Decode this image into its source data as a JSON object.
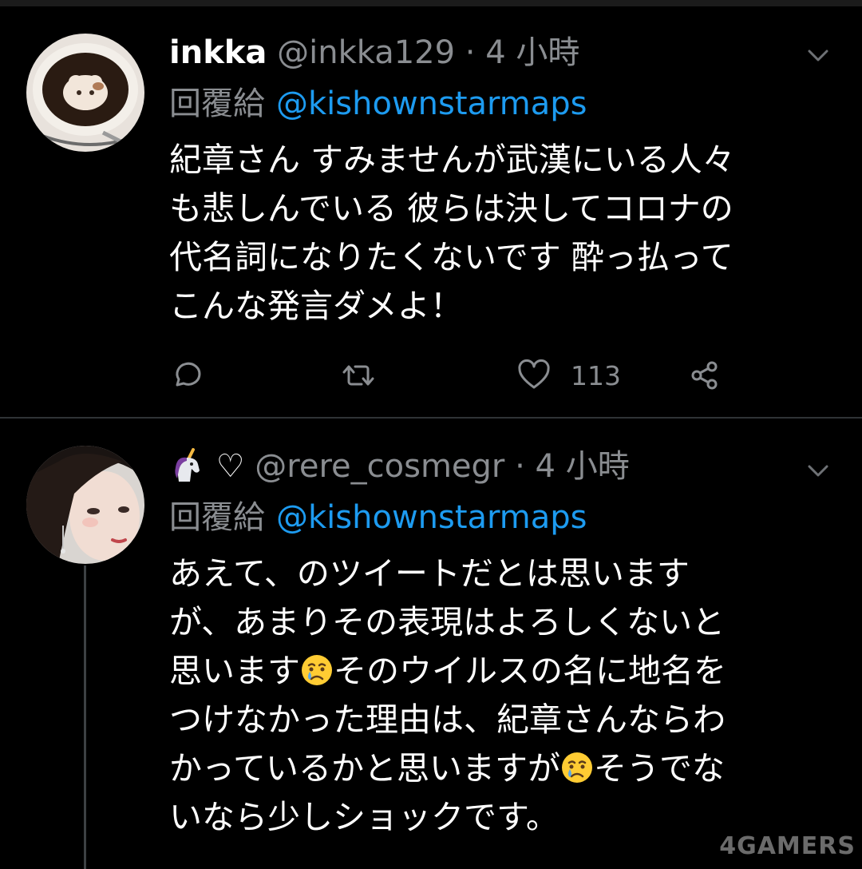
{
  "tweets": [
    {
      "display_name": "inkka",
      "handle": "@inkka129",
      "separator": "·",
      "time": "4 小時",
      "reply_label": "回覆給",
      "reply_to": "@kishownstarmaps",
      "lines": [
        "紀章さん すみませんが武漢にいる人々",
        "も悲しんでいる 彼らは決してコロナの",
        "代名詞になりたくないです 酔っ払って",
        "こんな発言ダメよ！"
      ],
      "like_count": "113"
    },
    {
      "display_name_icons": [
        "unicorn-emoji",
        "heart-outline"
      ],
      "display_name_heart": "♡",
      "handle": "@rere_cosmegr",
      "separator": "·",
      "time": "4 小時",
      "reply_label": "回覆給",
      "reply_to": "@kishownstarmaps",
      "lines": [
        "あえて、のツイートだとは思います",
        "が、あまりその表現はよろしくないと",
        "思います",
        "そのウイルスの名に地名を",
        "つけなかった理由は、紀章さんならわ",
        "かっているかと思いますが",
        "そうでな",
        "いなら少しショックです。"
      ]
    }
  ],
  "watermark": "4GAMERS",
  "colors": {
    "background": "#000000",
    "secondary_text": "#8a8d91",
    "mention": "#1d9bf0",
    "divider": "#2f3336"
  }
}
